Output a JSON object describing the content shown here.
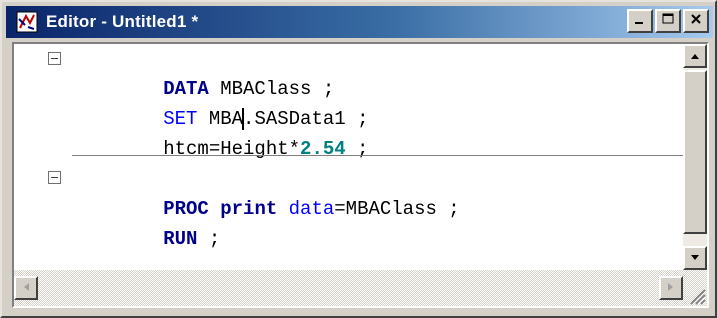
{
  "window": {
    "title": "Editor - Untitled1 *",
    "icon": "sas-editor-icon",
    "controls": [
      "minimize",
      "maximize",
      "close"
    ]
  },
  "editor": {
    "lines": [
      {
        "fold": "collapse",
        "tokens": [
          {
            "t": "DATA",
            "c": "kw"
          },
          {
            "t": " MBAClass ;",
            "c": "txt"
          }
        ]
      },
      {
        "fold": null,
        "tokens": [
          {
            "t": "SET",
            "c": "kw2"
          },
          {
            "t": " MBA",
            "c": "txt"
          },
          {
            "t": "|",
            "c": "cursor"
          },
          {
            "t": ".SASData1 ;",
            "c": "txt"
          }
        ]
      },
      {
        "fold": null,
        "tokens": [
          {
            "t": "htcm=Height*",
            "c": "txt"
          },
          {
            "t": "2.54",
            "c": "num"
          },
          {
            "t": " ;",
            "c": "txt"
          }
        ]
      },
      {
        "fold": "collapse",
        "tokens": [
          {
            "t": "PROC",
            "c": "kw"
          },
          {
            "t": " ",
            "c": "txt"
          },
          {
            "t": "print",
            "c": "kw"
          },
          {
            "t": " ",
            "c": "txt"
          },
          {
            "t": "data",
            "c": "kw2"
          },
          {
            "t": "=MBAClass ;",
            "c": "txt"
          }
        ]
      },
      {
        "fold": null,
        "tokens": [
          {
            "t": "RUN",
            "c": "kw"
          },
          {
            "t": " ;",
            "c": "txt"
          }
        ]
      }
    ]
  },
  "colors": {
    "keyword": "#00008b",
    "option": "#0000ff",
    "number": "#008080",
    "titlebar_start": "#0a246a",
    "titlebar_end": "#a6caf0"
  }
}
